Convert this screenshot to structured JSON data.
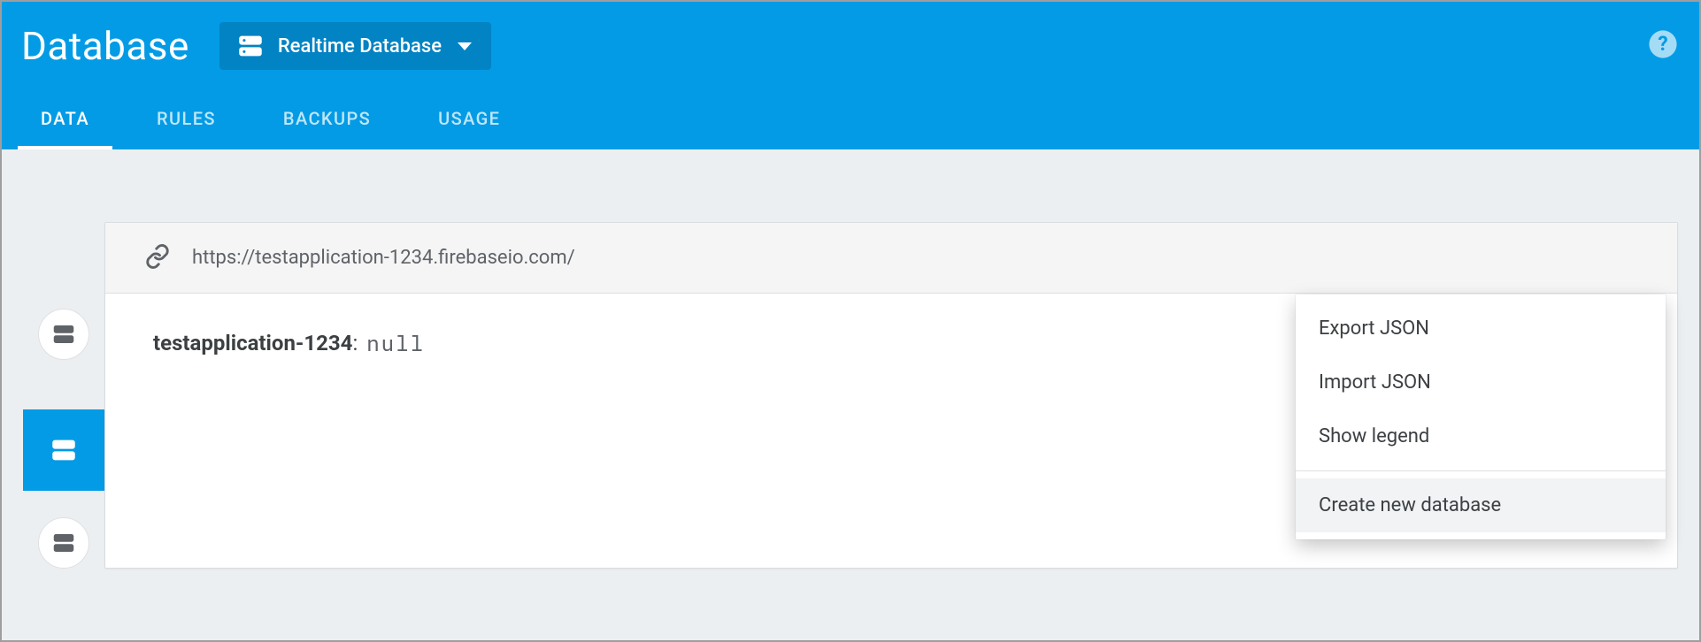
{
  "header": {
    "title": "Database",
    "db_select_label": "Realtime Database"
  },
  "tabs": [
    {
      "label": "DATA",
      "active": true
    },
    {
      "label": "RULES",
      "active": false
    },
    {
      "label": "BACKUPS",
      "active": false
    },
    {
      "label": "USAGE",
      "active": false
    }
  ],
  "url": "https://testapplication-1234.firebaseio.com/",
  "root_node": {
    "key": "testapplication-1234",
    "value": "null"
  },
  "menu": {
    "group1": [
      "Export JSON",
      "Import JSON",
      "Show legend"
    ],
    "group2": [
      "Create new database"
    ],
    "hovered": "Create new database"
  }
}
